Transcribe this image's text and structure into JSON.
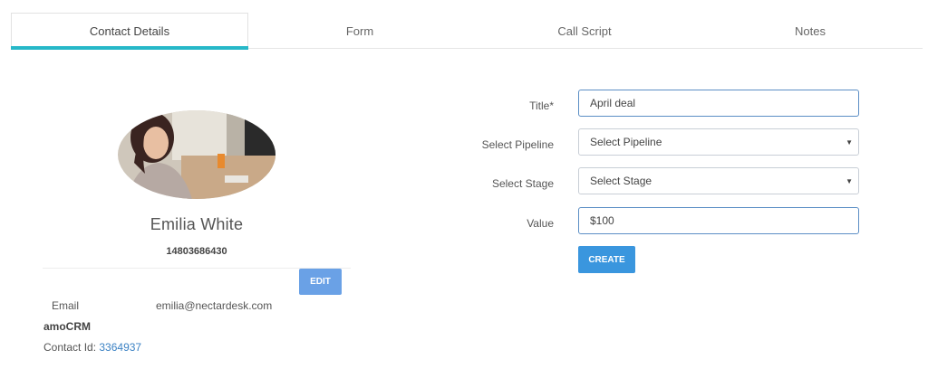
{
  "tabs": [
    {
      "label": "Contact Details",
      "active": true
    },
    {
      "label": "Form",
      "active": false
    },
    {
      "label": "Call Script",
      "active": false
    },
    {
      "label": "Notes",
      "active": false
    }
  ],
  "contact": {
    "name": "Emilia White",
    "phone": "14803686430",
    "edit_label": "EDIT",
    "email_label": "Email",
    "email_value": "emilia@nectardesk.com",
    "crm_name": "amoCRM",
    "contact_id_label": "Contact Id:",
    "contact_id_value": "3364937"
  },
  "deal_form": {
    "title_label": "Title*",
    "title_value": "April deal",
    "pipeline_label": "Select Pipeline",
    "pipeline_value": "Select Pipeline",
    "stage_label": "Select Stage",
    "stage_value": "Select Stage",
    "value_label": "Value",
    "value_value": "$100",
    "create_label": "CREATE"
  },
  "colors": {
    "tab_accent": "#27b8c8",
    "edit_button": "#6aa1e6",
    "create_button": "#3a96de",
    "link": "#3b82c4"
  }
}
